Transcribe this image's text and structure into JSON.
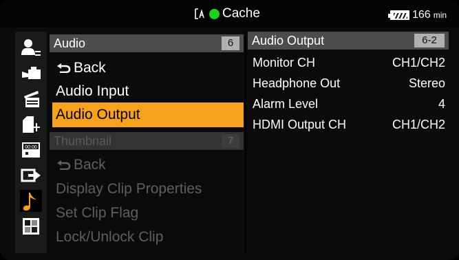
{
  "status": {
    "media_label": "Cache",
    "battery_value": "166",
    "battery_unit": "min",
    "rec_indicator_color": "#1fd11f"
  },
  "sidebar": {
    "icons": [
      "user-menu-icon",
      "camera-icon",
      "clapper-icon",
      "media-card-icon",
      "timecode-icon",
      "output-icon",
      "audio-note-icon",
      "thumbnail-icon"
    ],
    "active_color": "#f7a21c"
  },
  "menu": {
    "section1": {
      "title": "Audio",
      "number": "6"
    },
    "items1": [
      "Back",
      "Audio Input",
      "Audio Output"
    ],
    "section2": {
      "title": "Thumbnail",
      "number": "7"
    },
    "items2": [
      "Back",
      "Display Clip Properties",
      "Set Clip Flag",
      "Lock/Unlock Clip"
    ],
    "selected": "Audio Output",
    "selected_color": "#f7a21c"
  },
  "detail": {
    "title": "Audio Output",
    "number": "6-2",
    "rows": [
      {
        "label": "Monitor CH",
        "value": "CH1/CH2"
      },
      {
        "label": "Headphone Out",
        "value": "Stereo"
      },
      {
        "label": "Alarm Level",
        "value": "4"
      },
      {
        "label": "HDMI Output CH",
        "value": "CH1/CH2"
      }
    ]
  }
}
